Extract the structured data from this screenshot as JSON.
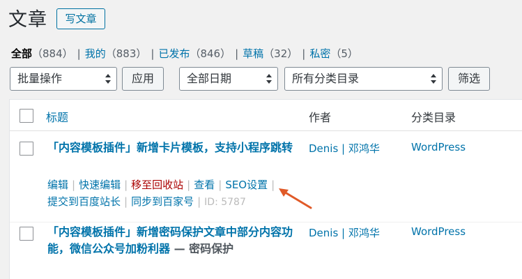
{
  "header": {
    "title": "文章",
    "add_new": "写文章"
  },
  "views": [
    {
      "label": "全部",
      "count": "（884）",
      "current": true
    },
    {
      "label": "我的",
      "count": "（883）"
    },
    {
      "label": "已发布",
      "count": "（846）"
    },
    {
      "label": "草稿",
      "count": "（32）"
    },
    {
      "label": "私密",
      "count": "（5）"
    }
  ],
  "filters": {
    "bulk_action": "批量操作",
    "apply": "应用",
    "date": "全部日期",
    "category": "所有分类目录",
    "filter_button": "筛选"
  },
  "table": {
    "columns": {
      "title": "标题",
      "author": "作者",
      "category": "分类目录"
    },
    "rows": [
      {
        "title": "「内容模板插件」新增卡片模板，支持小程序跳转",
        "author": "Denis | 邓鸿华",
        "category": "WordPress",
        "actions": {
          "edit": "编辑",
          "quick_edit": "快速编辑",
          "trash": "移至回收站",
          "view": "查看",
          "seo": "SEO设置",
          "baidu": "提交到百度站长",
          "baijia": "同步到百家号",
          "id": "ID: 5787"
        }
      },
      {
        "title": "「内容模板插件」新增密码保护文章中部分内容功能，微信公众号加粉利器",
        "state": " — 密码保护",
        "author": "Denis | 邓鸿华",
        "category": "WordPress"
      }
    ]
  },
  "annotation": {
    "arrow_color": "#e05a28"
  }
}
